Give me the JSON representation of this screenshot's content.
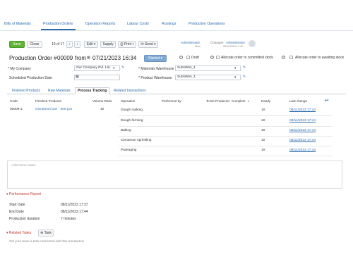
{
  "nav": {
    "items": [
      "Bills of Materials",
      "Production Orders",
      "Operation Reports",
      "Labour Costs",
      "Routings",
      "Production Operations"
    ],
    "active_index": 1
  },
  "toolbar": {
    "save": "Save",
    "close": "Close",
    "pager": "10 of 17",
    "edit": "Edit",
    "supply": "Supply",
    "print": "Print",
    "send": "Send"
  },
  "user": {
    "name": "Administrator",
    "role": "Main",
    "changes_label": "Changes:",
    "changes_by": "Administrator",
    "changes_date": "08/11/2023 17:44"
  },
  "header": {
    "title_prefix": "Production Order #",
    "number": "00009",
    "from_label": "from",
    "date": "07/21/2023 16:34",
    "status": "Started",
    "draft_label": "Draft",
    "allocate_committed": "Allocate order to committed stock",
    "allocate_awaiting": "Allocate order to awaiting stock"
  },
  "form": {
    "company_label": "* My Company",
    "company_value": "Our Company Pvt. Ltd.",
    "scheduled_label": "Scheduled Production Date",
    "materials_wh_label": "* Materials Warehouse",
    "materials_wh_value": "SubsWhs_1",
    "product_wh_label": "* Product Warehouse",
    "product_wh_value": "SubsWhs_1"
  },
  "tabs": [
    "Finished Products",
    "Raw Materials",
    "Process Tracking",
    "Related transactions"
  ],
  "active_tab": 2,
  "table": {
    "columns": [
      "Code",
      "Finished Products",
      "Volume Ratio",
      "Operation",
      "Performed by",
      "To Be Produced",
      "Complete",
      "Ready",
      "Last change"
    ],
    "product": {
      "code": "00009-1",
      "name": "Cinnamon bun - 200 pcs",
      "volume": "10"
    },
    "operations": [
      {
        "name": "Dough making",
        "ready": "10",
        "last_change": "08/11/2023 17:44"
      },
      {
        "name": "Dough forming",
        "ready": "10",
        "last_change": "08/11/2023 17:44"
      },
      {
        "name": "Baking",
        "ready": "10",
        "last_change": "08/11/2023 17:44"
      },
      {
        "name": "Cinnamon sprinkling",
        "ready": "10",
        "last_change": "08/11/2023 17:44"
      },
      {
        "name": "Packaging",
        "ready": "10",
        "last_change": "08/11/2023 17:44"
      }
    ]
  },
  "notes_placeholder": "Add some notes",
  "performance": {
    "title": "Performance Report",
    "start_label": "Start Date",
    "start_value": "08/11/2023 17:37",
    "end_label": "End Date",
    "end_value": "08/11/2023 17:44",
    "duration_label": "Production duration",
    "duration_value": "7 minutes"
  },
  "tasks": {
    "title": "Related Tasks",
    "task_button": "Task",
    "hint": "Set your team a task connected with this transaction"
  },
  "colors": {
    "accent": "#2b6cb0",
    "save": "#5fb336",
    "status": "#7fa8d4",
    "section": "#c0392b"
  }
}
